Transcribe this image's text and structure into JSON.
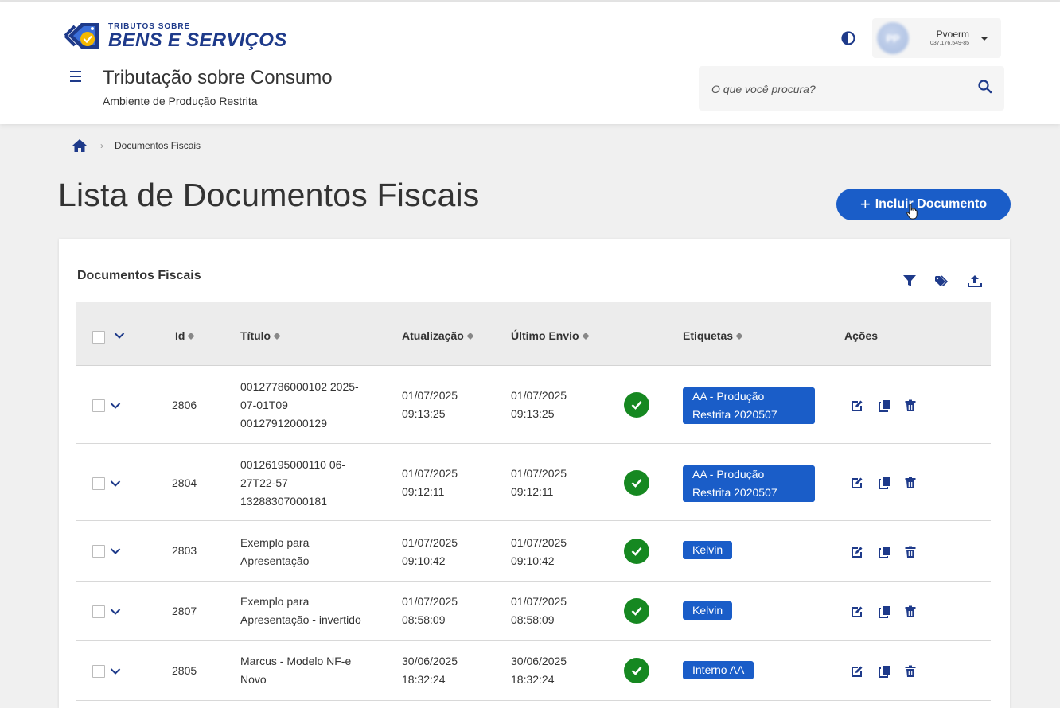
{
  "brand": {
    "line1": "TRIBUTOS SOBRE",
    "line2": "BENS E SERVIÇOS"
  },
  "header": {
    "title": "Tributação sobre Consumo",
    "subtitle": "Ambiente de Produção Restrita",
    "search_placeholder": "O que você procura?",
    "user": {
      "initials": "PP",
      "name": "Pvoerm",
      "cpf": "037.176.549-85"
    }
  },
  "breadcrumb": {
    "current": "Documentos Fiscais"
  },
  "page": {
    "title": "Lista de Documentos Fiscais",
    "add_button": "Incluir Documento",
    "add_symbol": "+"
  },
  "card": {
    "title": "Documentos Fiscais"
  },
  "colors": {
    "primary": "#1a5dc8",
    "brand_navy": "#1e3a8a",
    "success": "#168821",
    "brand_yellow": "#f5b800"
  },
  "table": {
    "columns": {
      "id": "Id",
      "titulo": "Título",
      "atualizacao": "Atualização",
      "ultimo_envio": "Último Envio",
      "etiquetas": "Etiquetas",
      "acoes": "Ações"
    },
    "rows": [
      {
        "id": "2806",
        "title_lines": [
          "00127786000102 2025-",
          "07-01T09",
          "00127912000129"
        ],
        "atualizacao": [
          "01/07/2025",
          "09:13:25"
        ],
        "ultimo_envio": [
          "01/07/2025",
          "09:13:25"
        ],
        "tag_lines": [
          "AA - Produção",
          "Restrita 2020507"
        ]
      },
      {
        "id": "2804",
        "title_lines": [
          "00126195000110 06-",
          "27T22-57",
          "13288307000181"
        ],
        "atualizacao": [
          "01/07/2025",
          "09:12:11"
        ],
        "ultimo_envio": [
          "01/07/2025",
          "09:12:11"
        ],
        "tag_lines": [
          "AA - Produção",
          "Restrita 2020507"
        ]
      },
      {
        "id": "2803",
        "title_lines": [
          "Exemplo para",
          "Apresentação"
        ],
        "atualizacao": [
          "01/07/2025",
          "09:10:42"
        ],
        "ultimo_envio": [
          "01/07/2025",
          "09:10:42"
        ],
        "tag_lines": [
          "Kelvin"
        ]
      },
      {
        "id": "2807",
        "title_lines": [
          "Exemplo para",
          "Apresentação - invertido"
        ],
        "atualizacao": [
          "01/07/2025",
          "08:58:09"
        ],
        "ultimo_envio": [
          "01/07/2025",
          "08:58:09"
        ],
        "tag_lines": [
          "Kelvin"
        ]
      },
      {
        "id": "2805",
        "title_lines": [
          "Marcus - Modelo NF-e",
          "Novo"
        ],
        "atualizacao": [
          "30/06/2025",
          "18:32:24"
        ],
        "ultimo_envio": [
          "30/06/2025",
          "18:32:24"
        ],
        "tag_lines": [
          "Interno AA"
        ]
      }
    ]
  }
}
